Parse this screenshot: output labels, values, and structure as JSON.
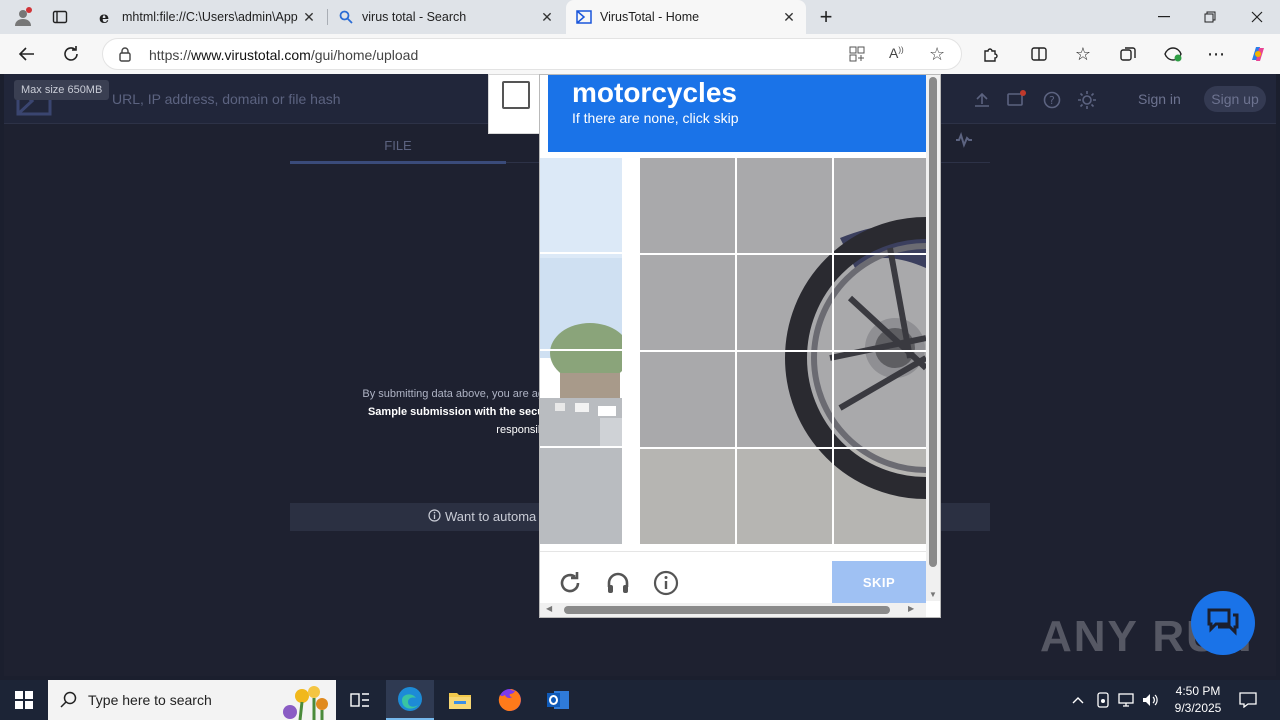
{
  "browser": {
    "tabs": [
      {
        "title": "mhtml:file://C:\\Users\\admin\\AppD",
        "icon": "ie-icon"
      },
      {
        "title": "virus total - Search",
        "icon": "search-icon"
      },
      {
        "title": "VirusTotal - Home",
        "icon": "virustotal-icon",
        "active": true
      }
    ],
    "url_prefix": "https://",
    "url_host": "www.virustotal.com",
    "url_path": "/gui/home/upload"
  },
  "virustotal": {
    "search_placeholder": "URL, IP address, domain or file hash",
    "tooltip": "Max size 650MB",
    "sign_in": "Sign in",
    "sign_up": "Sign up",
    "tab_file": "FILE",
    "disclaimer_line1": "By submitting data above, you are ag",
    "disclaimer_line2": "Sample submission with the secu",
    "disclaimer_line3": "responsib",
    "automate": "Want to automa"
  },
  "captcha": {
    "target": "motorcycles",
    "instruction": "If there are none, click skip",
    "skip": "SKIP"
  },
  "watermark": "ANY RUN",
  "taskbar": {
    "search_placeholder": "Type here to search",
    "time": "4:50 PM",
    "date": "9/3/2025"
  }
}
